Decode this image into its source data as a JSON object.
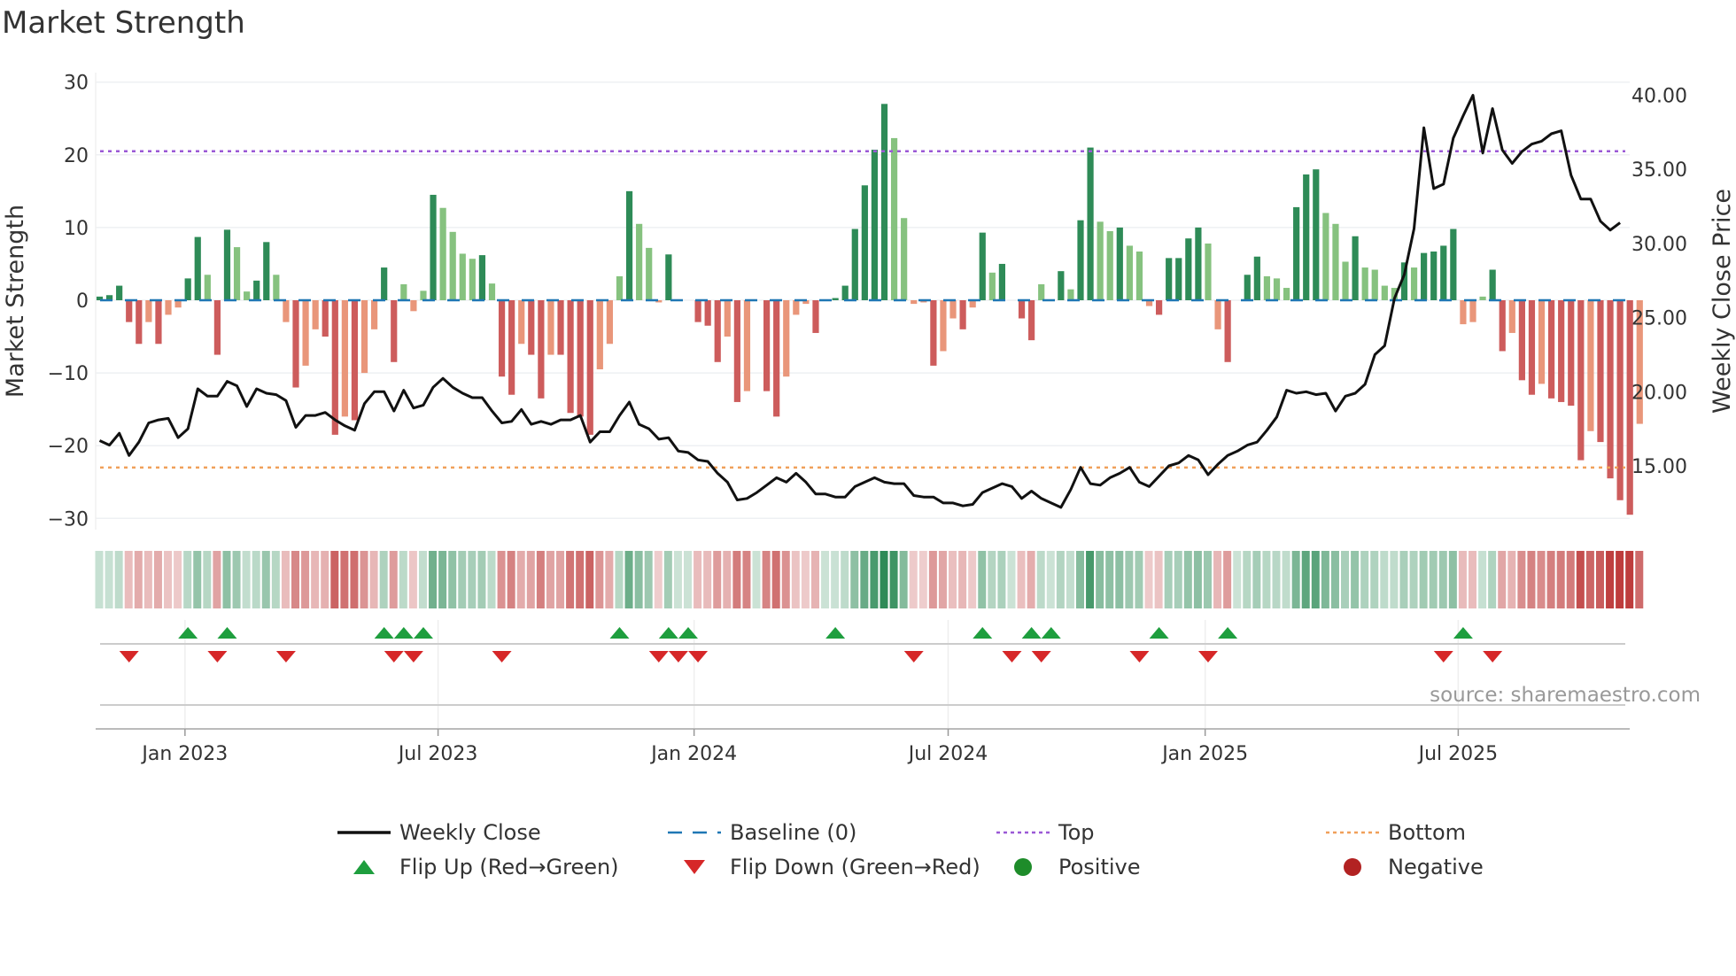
{
  "title": "Market Strength",
  "source": "source: sharemaestro.com",
  "chart_data": {
    "type": "bar",
    "title": "Market Strength",
    "ylabel": "Market Strength",
    "y2label": "Weekly Close Price",
    "ylim": [
      -30,
      30
    ],
    "y2lim": [
      15,
      40
    ],
    "yticks": [
      "30",
      "20",
      "10",
      "0",
      "−10",
      "−20",
      "−30"
    ],
    "yticks_values": [
      30,
      20,
      10,
      0,
      -10,
      -20,
      -30
    ],
    "y2ticks": [
      "40.00",
      "35.00",
      "30.00",
      "25.00",
      "20.00",
      "15.00"
    ],
    "y2ticks_values": [
      40,
      35,
      30,
      25,
      20,
      15
    ],
    "xticks": [
      "Jan 2023",
      "Jul 2023",
      "Jan 2024",
      "Jul 2024",
      "Jan 2025",
      "Jul 2025"
    ],
    "xticks_week_index": [
      8.7,
      34.5,
      60.6,
      86.5,
      112.7,
      138.5
    ],
    "top_level": 20.5,
    "bottom_level": -23,
    "strength": [
      0.5,
      0.7,
      2,
      -3,
      -6,
      -3,
      -6,
      -2,
      -1,
      3,
      8.7,
      3.5,
      -7.5,
      9.7,
      7.3,
      1.2,
      2.7,
      8,
      3.5,
      -3,
      -12,
      -9,
      -4,
      -5,
      -18.5,
      -16,
      -16.5,
      -10,
      -4,
      4.5,
      -8.5,
      2.2,
      -1.5,
      1.3,
      14.5,
      12.7,
      9.4,
      6.4,
      5.7,
      6.2,
      2.3,
      -10.5,
      -13,
      -6,
      -7.5,
      -13.5,
      -7.5,
      -7.5,
      -15.5,
      -16,
      -18.5,
      -9.5,
      -6,
      3.3,
      15,
      10.5,
      7.2,
      -0.3,
      6.3,
      0,
      0,
      -3,
      -3.5,
      -8.5,
      -5,
      -14,
      -12.5,
      0,
      -12.5,
      -16,
      -10.5,
      -2,
      -0.5,
      -4.5,
      0,
      0.3,
      2,
      9.8,
      15.8,
      20.7,
      27,
      22.3,
      11.3,
      -0.5,
      -0.3,
      -9,
      -7,
      -2.5,
      -4,
      -1,
      9.3,
      3.8,
      5,
      0,
      -2.5,
      -5.5,
      2.2,
      0,
      4,
      1.5,
      11,
      21,
      10.8,
      9.5,
      10,
      7.5,
      6.7,
      -0.8,
      -2,
      5.8,
      5.8,
      8.5,
      10,
      7.8,
      -4,
      -8.5,
      0,
      3.5,
      6,
      3.3,
      3,
      1.7,
      12.8,
      17.3,
      18,
      12,
      10.5,
      5.3,
      8.8,
      4.5,
      4.2,
      2,
      1.7,
      5.2,
      4.5,
      6.5,
      6.7,
      7.5,
      9.8,
      -3.3,
      -3,
      0.5,
      4.2,
      -7,
      -4.5,
      -11,
      -13,
      -11.5,
      -13.5,
      -14,
      -14.5,
      -22,
      -18,
      -19.5,
      -24.5,
      -27.5,
      -29.5,
      -17
    ],
    "weekly_close": [
      16.7,
      16.4,
      17.2,
      15.7,
      16.6,
      17.9,
      18.1,
      18.2,
      16.9,
      17.5,
      20.2,
      19.7,
      19.7,
      20.7,
      20.4,
      19.0,
      20.2,
      19.9,
      19.8,
      19.4,
      17.6,
      18.4,
      18.4,
      18.6,
      18.1,
      17.7,
      17.4,
      19.2,
      20.0,
      20.0,
      18.7,
      20.1,
      18.9,
      19.1,
      20.3,
      20.9,
      20.3,
      19.9,
      19.6,
      19.6,
      18.7,
      17.9,
      18.0,
      18.8,
      17.8,
      18.0,
      17.8,
      18.1,
      18.1,
      18.4,
      16.6,
      17.3,
      17.3,
      18.4,
      19.3,
      17.8,
      17.5,
      16.8,
      16.9,
      16.0,
      15.9,
      15.4,
      15.3,
      14.5,
      13.9,
      12.7,
      12.8,
      13.2,
      13.7,
      14.2,
      13.9,
      14.5,
      13.9,
      13.1,
      13.1,
      12.9,
      12.9,
      13.6,
      13.9,
      14.2,
      13.9,
      13.8,
      13.8,
      13.0,
      12.9,
      12.9,
      12.5,
      12.5,
      12.3,
      12.4,
      13.2,
      13.5,
      13.8,
      13.6,
      12.8,
      13.3,
      12.8,
      12.5,
      12.2,
      13.4,
      14.9,
      13.8,
      13.7,
      14.2,
      14.5,
      14.9,
      13.9,
      13.6,
      14.3,
      15.0,
      15.2,
      15.7,
      15.4,
      14.4,
      15.1,
      15.7,
      16.0,
      16.4,
      16.6,
      17.4,
      18.3,
      20.1,
      19.9,
      20.0,
      19.8,
      19.9,
      18.7,
      19.7,
      19.9,
      20.5,
      22.5,
      23.1,
      26.3,
      27.9,
      31.0,
      37.8,
      33.7,
      34.0,
      37.1,
      38.6,
      40.0,
      36.1,
      39.1,
      36.3,
      35.4,
      36.2,
      36.7,
      36.9,
      37.4,
      37.6,
      34.6,
      33.0,
      33.0,
      31.5,
      30.9,
      31.4
    ],
    "flip_up_week_index": [
      9,
      13,
      29,
      31,
      33,
      53,
      58,
      60,
      75,
      90,
      95,
      97,
      108,
      115,
      139
    ],
    "flip_down_week_index": [
      3,
      12,
      19,
      30,
      32,
      41,
      57,
      59,
      61,
      83,
      93,
      96,
      106,
      113,
      137,
      142
    ],
    "legend": [
      {
        "label": "Weekly Close",
        "kind": "line",
        "color": "#111111"
      },
      {
        "label": "Baseline (0)",
        "kind": "dash",
        "color": "#1f77b4"
      },
      {
        "label": "Top",
        "kind": "dot",
        "color": "#9b59d6"
      },
      {
        "label": "Bottom",
        "kind": "dot",
        "color": "#f0a05a"
      },
      {
        "label": "Flip Up (Red→Green)",
        "kind": "up",
        "color": "#1e9e3e"
      },
      {
        "label": "Flip Down (Green→Red)",
        "kind": "down",
        "color": "#d62728"
      },
      {
        "label": "Positive",
        "kind": "circle",
        "color": "#1e8c2a"
      },
      {
        "label": "Negative",
        "kind": "circle",
        "color": "#b22222"
      }
    ],
    "colors": {
      "pos_strong": "#2e8b57",
      "pos_weak": "#86c27f",
      "neg_strong": "#cd5c5c",
      "neg_weak": "#e9967a",
      "top": "#9b59d6",
      "bottom": "#f0a05a",
      "baseline": "#1f77b4",
      "close": "#111111"
    }
  }
}
